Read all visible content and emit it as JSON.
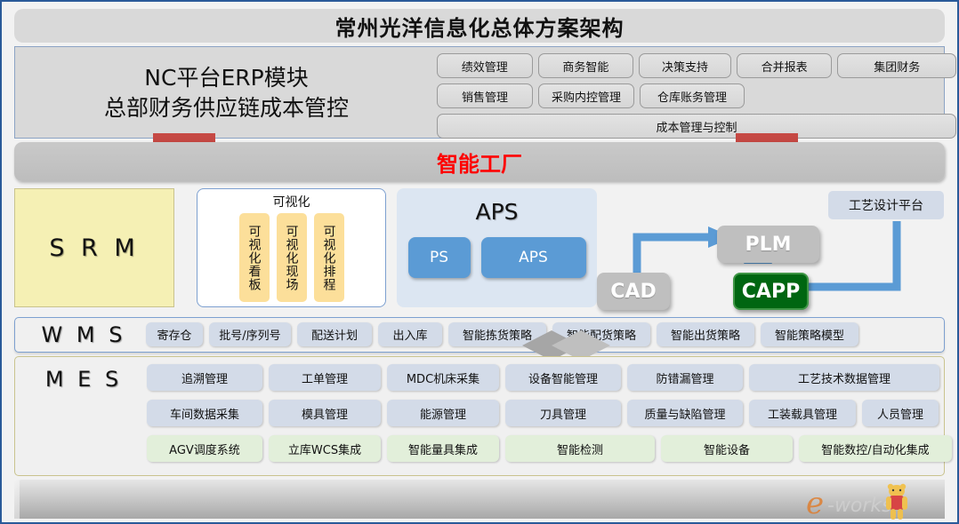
{
  "header": {
    "title": "常州光洋信息化总体方案架构"
  },
  "erp": {
    "left_line1": "NC平台ERP模块",
    "left_line2": "总部财务供应链成本管控",
    "row1": [
      "绩效管理",
      "商务智能",
      "决策支持",
      "合并报表",
      "集团财务"
    ],
    "row2": [
      "销售管理",
      "采购内控管理",
      "仓库账务管理"
    ],
    "row3": [
      "成本管理与控制"
    ]
  },
  "smart_factory": {
    "label": "智能工厂"
  },
  "srm": {
    "label": "S R M"
  },
  "visualization": {
    "title": "可视化",
    "columns": [
      "可视化看板",
      "可视化现场",
      "可视化排程"
    ]
  },
  "aps": {
    "title": "APS",
    "buttons": [
      "PS",
      "APS"
    ]
  },
  "plm_area": {
    "cad": "CAD",
    "plm": "PLM",
    "capp": "CAPP",
    "platform": "工艺设计平台"
  },
  "wms": {
    "label": "W M S",
    "items": [
      "寄存仓",
      "批号/序列号",
      "配送计划",
      "出入库",
      "智能拣货策略",
      "智能配货策略",
      "智能出货策略",
      "智能策略模型"
    ]
  },
  "mes": {
    "label": "M E S",
    "row1": [
      "追溯管理",
      "工单管理",
      "MDC机床采集",
      "设备智能管理",
      "防错漏管理",
      "工艺技术数据管理"
    ],
    "row2": [
      "车间数据采集",
      "模具管理",
      "能源管理",
      "刀具管理",
      "质量与缺陷管理",
      "工装载具管理",
      "人员管理"
    ],
    "row3": [
      "AGV调度系统",
      "立库WCS集成",
      "智能量具集成",
      "智能检测",
      "智能设备",
      "智能数控/自动化集成"
    ]
  },
  "watermark": {
    "text": "e-works"
  },
  "colors": {
    "accent_red": "#ff0000",
    "capp_green": "#006611",
    "aps_blue": "#5b9bd5",
    "srm_yellow": "#f5f0b4",
    "page_border": "#2a5a99"
  }
}
